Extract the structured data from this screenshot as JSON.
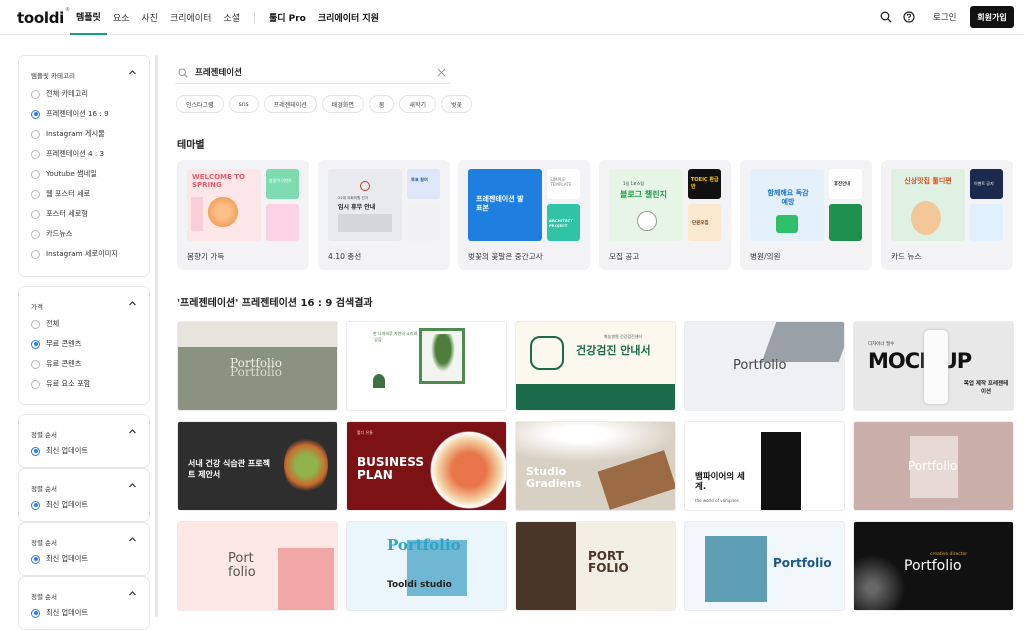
{
  "header": {
    "logo": "tooldi",
    "logo_mark": "®",
    "nav": [
      "템플릿",
      "요소",
      "사진",
      "크리에이터",
      "소셜"
    ],
    "nav_extra": [
      "툴디 Pro",
      "크리에이터 지원"
    ],
    "login": "로그인",
    "signup": "회원가입"
  },
  "sidebar": {
    "category": {
      "title": "템플릿 카테고리",
      "options": [
        "전체 카테고리",
        "프레젠테이션 16 : 9",
        "Instagram 게시물",
        "프레젠테이션 4 : 3",
        "Youtube 썸네일",
        "웹 포스터 세로",
        "포스터 세로형",
        "카드뉴스",
        "Instagram 세로이미지"
      ],
      "selected": 1
    },
    "price": {
      "title": "가격",
      "options": [
        "전체",
        "무료 콘텐츠",
        "유료 콘텐츠",
        "유료 요소 포함"
      ],
      "selected": 1
    },
    "sort_cards": [
      {
        "title": "정렬 순서",
        "option": "최신 업데이트"
      },
      {
        "title": "정렬 순서",
        "option": "최신 업데이트"
      },
      {
        "title": "정렬 순서",
        "option": "최신 업데이트"
      },
      {
        "title": "정렬 순서",
        "option": "최신 업데이트"
      }
    ]
  },
  "search": {
    "query": "프레젠테이션",
    "tags": [
      "인스타그램",
      "sns",
      "프레젠테이션",
      "배경화면",
      "봄",
      "새학기",
      "벚꽃"
    ]
  },
  "themes": {
    "title": "테마별",
    "items": [
      {
        "label": "봄향기 가득",
        "text1": "WELCOME TO SPRING",
        "text2": "봄맞이 이벤트"
      },
      {
        "label": "4.10 총선",
        "text1": "22대 국회의원 선거",
        "text2": "임시 휴무 안내",
        "text3": "투표 참여"
      },
      {
        "label": "벚꽃의 꽃말은 중간고사",
        "text1": "프레젠테이션 발표본",
        "text2": "SIMPLE TEMPLATE",
        "text3": "ARCHITECT PROJECT"
      },
      {
        "label": "모집 공고",
        "text1": "1일 1포스팅",
        "text2": "블로그 챌린지",
        "text3": "TOEIC 환급반",
        "text4": "단원모집"
      },
      {
        "label": "병원/의원",
        "text1": "함께해요 독감 예방",
        "text2": "휴진안내"
      },
      {
        "label": "카드 뉴스",
        "text1": "신상맛집 툴디편",
        "text2": "이벤트 공지"
      }
    ]
  },
  "results": {
    "title": "'프레젠테이션' 프레젠테이션 16 : 9 검색결과",
    "items": [
      {
        "t1": "Portfolio",
        "t2": "Portfolio"
      },
      {
        "t1": "한 나의하루 자연의 소리와 ‘공감’",
        "t2": ""
      },
      {
        "t1": "건강검진 안내서",
        "t2": "화농병원 건강검진센터"
      },
      {
        "t1": "Portfolio",
        "t2": ""
      },
      {
        "t1": "MOCK UP",
        "t2": "목업 제작 프레젠테이션",
        "t3": "디자이너 필수"
      },
      {
        "t1": "서내 건강 식습관 프로젝트 제안서",
        "t2": ""
      },
      {
        "t1": "BUSINESS PLAN",
        "t2": "툴디 유통"
      },
      {
        "t1": "Studio Gradiens",
        "t2": ""
      },
      {
        "t1": "뱀파이어의 세계.",
        "t2": "the world of vampires"
      },
      {
        "t1": "Portfolio",
        "t2": ""
      },
      {
        "t1": "Port folio",
        "t2": ""
      },
      {
        "t1": "Portfolio",
        "t2": "Tooldi studio"
      },
      {
        "t1": "PORT FOLIO",
        "t2": ""
      },
      {
        "t1": "Portfolio",
        "t2": ""
      },
      {
        "t1": "Portfolio",
        "t2": "creative director"
      }
    ]
  },
  "colors": {
    "accent": "#2b7de9",
    "active_tab": "#16a085",
    "signup_bg": "#111111"
  }
}
